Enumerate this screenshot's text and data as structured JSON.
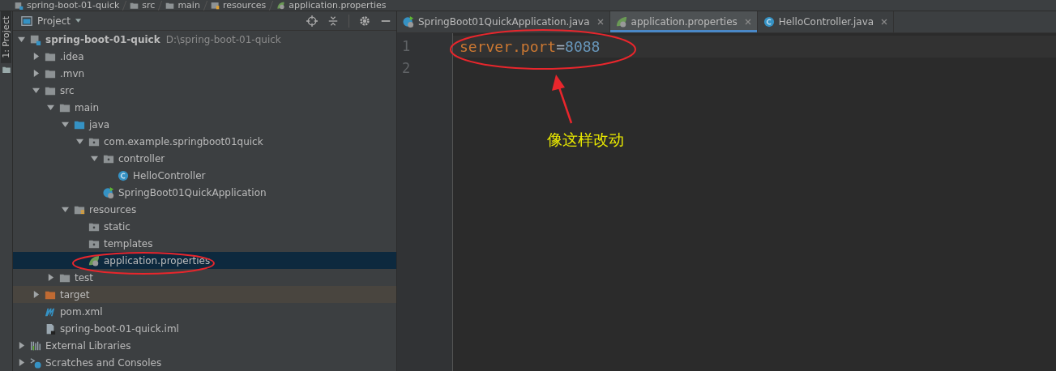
{
  "breadcrumb": [
    {
      "label": "spring-boot-01-quick",
      "kind": "module"
    },
    {
      "label": "src",
      "kind": "folder"
    },
    {
      "label": "main",
      "kind": "folder"
    },
    {
      "label": "resources",
      "kind": "resources"
    },
    {
      "label": "application.properties",
      "kind": "spring-properties"
    }
  ],
  "tool_strip": {
    "label": "1: Project",
    "selected": true
  },
  "project_panel": {
    "title": "Project",
    "tree": [
      {
        "label": "spring-boot-01-quick",
        "path": "D:\\spring-boot-01-quick",
        "kind": "module",
        "expanded": true,
        "selected": false,
        "children": [
          {
            "label": ".idea",
            "kind": "folder",
            "expanded": false,
            "selected": false
          },
          {
            "label": ".mvn",
            "kind": "folder",
            "expanded": false,
            "selected": false
          },
          {
            "label": "src",
            "kind": "folder",
            "expanded": true,
            "selected": false,
            "children": [
              {
                "label": "main",
                "kind": "folder",
                "expanded": true,
                "selected": false,
                "children": [
                  {
                    "label": "java",
                    "kind": "source-folder",
                    "expanded": true,
                    "selected": false,
                    "children": [
                      {
                        "label": "com.example.springboot01quick",
                        "kind": "package",
                        "expanded": true,
                        "selected": false,
                        "children": [
                          {
                            "label": "controller",
                            "kind": "package",
                            "expanded": true,
                            "selected": false,
                            "children": [
                              {
                                "label": "HelloController",
                                "kind": "class",
                                "selected": false
                              }
                            ]
                          },
                          {
                            "label": "SpringBoot01QuickApplication",
                            "kind": "spring-class",
                            "selected": false
                          }
                        ]
                      }
                    ]
                  },
                  {
                    "label": "resources",
                    "kind": "resources",
                    "expanded": true,
                    "selected": false,
                    "children": [
                      {
                        "label": "static",
                        "kind": "package",
                        "selected": false
                      },
                      {
                        "label": "templates",
                        "kind": "package",
                        "selected": false
                      },
                      {
                        "label": "application.properties",
                        "kind": "spring-properties",
                        "selected": true
                      }
                    ]
                  }
                ]
              },
              {
                "label": "test",
                "kind": "folder",
                "expanded": false,
                "selected": false
              }
            ]
          },
          {
            "label": "target",
            "kind": "excluded-folder",
            "expanded": false,
            "selected": false
          },
          {
            "label": "pom.xml",
            "kind": "maven",
            "selected": false
          },
          {
            "label": "spring-boot-01-quick.iml",
            "kind": "iml",
            "selected": false
          }
        ]
      },
      {
        "label": "External Libraries",
        "kind": "libraries",
        "expanded": false,
        "selected": false
      },
      {
        "label": "Scratches and Consoles",
        "kind": "scratches",
        "expanded": false,
        "selected": false
      }
    ]
  },
  "editor": {
    "tabs": [
      {
        "label": "SpringBoot01QuickApplication.java",
        "kind": "spring-class",
        "selected": false
      },
      {
        "label": "application.properties",
        "kind": "spring-properties",
        "selected": true
      },
      {
        "label": "HelloController.java",
        "kind": "class",
        "selected": false
      }
    ],
    "lines": [
      {
        "number": "1",
        "key": "server.port",
        "separator": "=",
        "value": "8088"
      },
      {
        "number": "2"
      }
    ]
  },
  "annotation": {
    "note": "像这样改动"
  }
}
